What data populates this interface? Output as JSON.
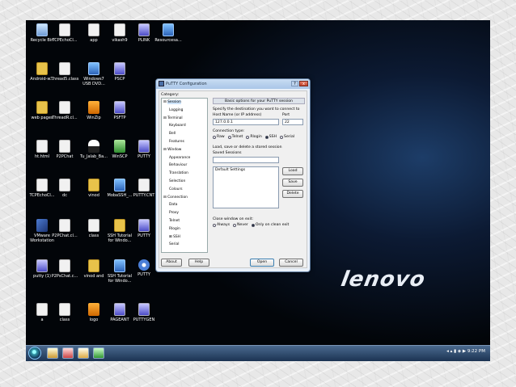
{
  "desktop": {
    "icons": [
      {
        "label": "Recycle Bin",
        "kind": "bin"
      },
      {
        "label": "TCPEchoCl...",
        "kind": "doc"
      },
      {
        "label": "app",
        "kind": "doc"
      },
      {
        "label": "vikash9",
        "kind": "doc"
      },
      {
        "label": "PLINK",
        "kind": "putty"
      },
      {
        "label": "Resourcesa...",
        "kind": "exe"
      },
      {
        "label": "Android-w...",
        "kind": "yellow"
      },
      {
        "label": "Thread5.class",
        "kind": "doc"
      },
      {
        "label": "Windows7 USB DVD...",
        "kind": "exe"
      },
      {
        "label": "PSCP",
        "kind": "putty"
      },
      {
        "label": "web pages",
        "kind": "yellow"
      },
      {
        "label": "ThreadR.cl...",
        "kind": "doc"
      },
      {
        "label": "WinZip",
        "kind": "orange"
      },
      {
        "label": "PSFTP",
        "kind": "putty"
      },
      {
        "label": "ht.html",
        "kind": "doc"
      },
      {
        "label": "P2PChat",
        "kind": "doc"
      },
      {
        "label": "Tu_Jalab_Ba...",
        "kind": "tux"
      },
      {
        "label": "WinSCP",
        "kind": "green"
      },
      {
        "label": "PUTTY",
        "kind": "putty"
      },
      {
        "label": "TCPEchoCl...",
        "kind": "doc"
      },
      {
        "label": "dc",
        "kind": "doc"
      },
      {
        "label": "vinod",
        "kind": "yellow"
      },
      {
        "label": "MobaSSH_...",
        "kind": "exe"
      },
      {
        "label": "PUTTY.CNT",
        "kind": "doc"
      },
      {
        "label": "VMware Workstation",
        "kind": "cube"
      },
      {
        "label": "P2PChat.cl...",
        "kind": "doc"
      },
      {
        "label": "class",
        "kind": "doc"
      },
      {
        "label": "SSH Tutorial for Windo...",
        "kind": "yellow"
      },
      {
        "label": "PUTTY",
        "kind": "putty"
      },
      {
        "label": "putty (1)",
        "kind": "putty"
      },
      {
        "label": "P2PsChat.c...",
        "kind": "doc"
      },
      {
        "label": "vinod and",
        "kind": "yellow"
      },
      {
        "label": "SSH Tutorial for Windo...",
        "kind": "exe"
      },
      {
        "label": "PUTTY",
        "kind": "help"
      },
      {
        "label": "a",
        "kind": "doc"
      },
      {
        "label": "class",
        "kind": "doc"
      },
      {
        "label": "logo",
        "kind": "orange"
      },
      {
        "label": "PAGEANT",
        "kind": "putty"
      },
      {
        "label": "PUTTYGEN",
        "kind": "putty"
      }
    ],
    "brand": "lenovo"
  },
  "putty": {
    "title": "PuTTY Configuration",
    "help": "?",
    "close": "x",
    "category_label": "Category:",
    "tree": [
      "Session",
      "Logging",
      "Terminal",
      "Keyboard",
      "Bell",
      "Features",
      "Window",
      "Appearance",
      "Behaviour",
      "Translation",
      "Selection",
      "Colours",
      "Connection",
      "Data",
      "Proxy",
      "Telnet",
      "Rlogin",
      "SSH",
      "Serial"
    ],
    "panel_title": "Basic options for your PuTTY session",
    "destination_label": "Specify the destination you want to connect to",
    "host_label": "Host Name (or IP address)",
    "port_label": "Port",
    "host_value": "127.0.0.1",
    "port_value": "22",
    "conn_type_label": "Connection type:",
    "conn_types": [
      "Raw",
      "Telnet",
      "Rlogin",
      "SSH",
      "Serial"
    ],
    "sessions_label": "Load, save or delete a stored session",
    "saved_sessions_label": "Saved Sessions",
    "saved_sessions_value": "",
    "sessions": [
      "Default Settings"
    ],
    "load": "Load",
    "save": "Save",
    "delete": "Delete",
    "close_exit_label": "Close window on exit:",
    "close_exit_options": [
      "Always",
      "Never",
      "Only on clean exit"
    ],
    "about": "About",
    "help_btn": "Help",
    "open": "Open",
    "cancel": "Cancel"
  },
  "taskbar": {
    "clock": "9:22 PM"
  }
}
